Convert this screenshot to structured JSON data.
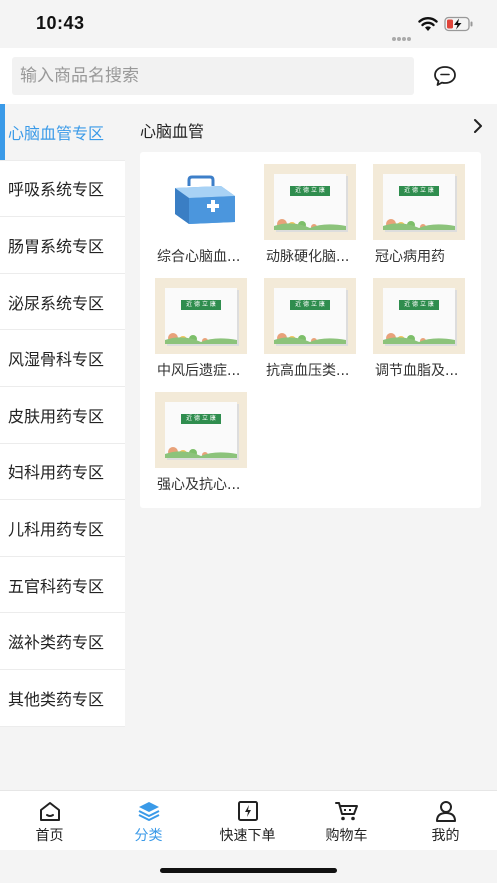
{
  "status_bar": {
    "time": "10:43",
    "icons": [
      "cellular-icon",
      "wifi-icon",
      "battery-charging-icon"
    ]
  },
  "search": {
    "placeholder": "输入商品名搜索",
    "message_icon": "chat-bubble-icon"
  },
  "sidebar": {
    "items": [
      {
        "label": "心脑血管专区",
        "active": true
      },
      {
        "label": "呼吸系统专区",
        "active": false
      },
      {
        "label": "肠胃系统专区",
        "active": false
      },
      {
        "label": "泌尿系统专区",
        "active": false
      },
      {
        "label": "风湿骨科专区",
        "active": false
      },
      {
        "label": "皮肤用药专区",
        "active": false
      },
      {
        "label": "妇科用药专区",
        "active": false
      },
      {
        "label": "儿科用药专区",
        "active": false
      },
      {
        "label": "五官科药专区",
        "active": false
      },
      {
        "label": "滋补类药专区",
        "active": false
      },
      {
        "label": "其他类药专区",
        "active": false
      }
    ]
  },
  "category": {
    "title": "心脑血管",
    "subcategories": [
      {
        "label": "综合心脑血...",
        "image": "medicine-kit-icon"
      },
      {
        "label": "动脉硬化脑...",
        "image": "product-box-image"
      },
      {
        "label": "冠心病用药",
        "image": "product-box-image"
      },
      {
        "label": "中风后遗症...",
        "image": "product-box-image"
      },
      {
        "label": "抗高血压类...",
        "image": "product-box-image"
      },
      {
        "label": "调节血脂及...",
        "image": "product-box-image"
      },
      {
        "label": "强心及抗心...",
        "image": "product-box-image"
      }
    ],
    "box_band_text": "近 德 立 康"
  },
  "tabbar": {
    "tabs": [
      {
        "label": "首页",
        "icon": "home-icon",
        "active": false
      },
      {
        "label": "分类",
        "icon": "layers-icon",
        "active": true
      },
      {
        "label": "快速下单",
        "icon": "quick-order-icon",
        "active": false
      },
      {
        "label": "购物车",
        "icon": "cart-icon",
        "active": false
      },
      {
        "label": "我的",
        "icon": "user-icon",
        "active": false
      }
    ]
  },
  "colors": {
    "accent": "#3a9ae8",
    "background": "#f4f4f4",
    "box_band": "#2f8d4e"
  }
}
